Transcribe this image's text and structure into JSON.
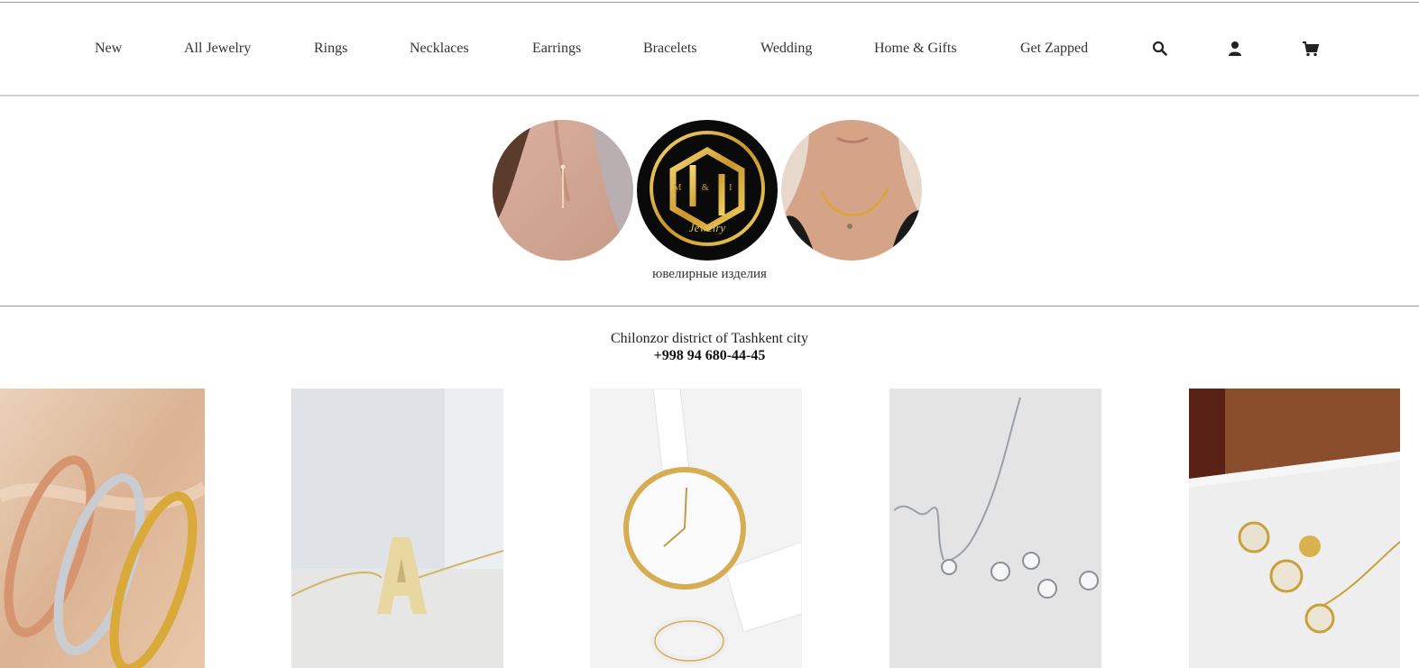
{
  "nav": {
    "items": [
      {
        "label": "New"
      },
      {
        "label": "All Jewelry"
      },
      {
        "label": "Rings"
      },
      {
        "label": "Necklaces"
      },
      {
        "label": "Earrings"
      },
      {
        "label": "Bracelets"
      },
      {
        "label": "Wedding"
      },
      {
        "label": "Home & Gifts"
      },
      {
        "label": "Get Zapped"
      }
    ],
    "icons": [
      "search-icon",
      "account-icon",
      "cart-icon"
    ]
  },
  "brand": {
    "logo_letters": "M & I",
    "logo_word": "Jewelry",
    "caption": "ювелирные изделия"
  },
  "contact": {
    "address": "Chilonzor district of Tashkent city",
    "phone": "+998 94 680-44-45"
  },
  "products": [
    {
      "subject": "bangle bracelets in rose gold, silver and gold"
    },
    {
      "subject": "gold letter A pendant necklace"
    },
    {
      "subject": "white leather strap watch with gold case and white ring"
    },
    {
      "subject": "silver necklace with diamond stud earrings"
    },
    {
      "subject": "gold flower cluster earrings and pendant"
    }
  ],
  "colors": {
    "text": "#333333",
    "divider": "#9a9a9a",
    "logo_gold": "#d4a93a",
    "logo_bg": "#0a0a0a"
  }
}
